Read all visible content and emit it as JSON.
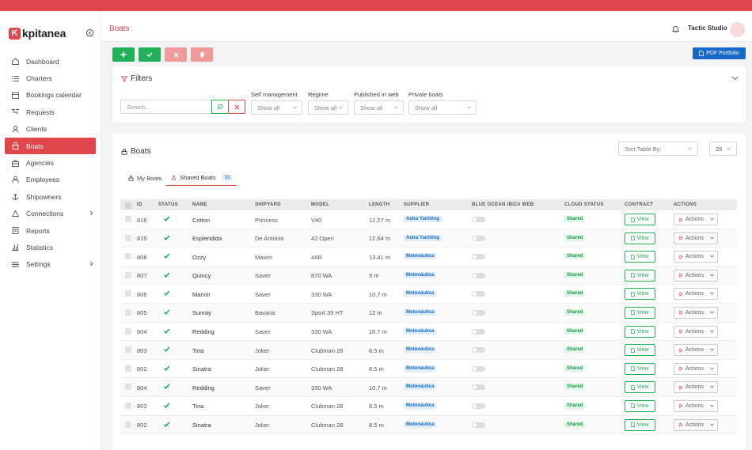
{
  "brand": {
    "name": "kpitanea",
    "logo_letter": "K",
    "accent": "#e0474c"
  },
  "sidebar": {
    "items": [
      {
        "label": "Dashboard",
        "icon": "home-icon",
        "active": false,
        "has_submenu": false
      },
      {
        "label": "Charters",
        "icon": "list-icon",
        "active": false,
        "has_submenu": false
      },
      {
        "label": "Bookings calendar",
        "icon": "calendar-icon",
        "active": false,
        "has_submenu": false
      },
      {
        "label": "Requests",
        "icon": "requests-icon",
        "active": false,
        "has_submenu": false
      },
      {
        "label": "Clients",
        "icon": "user-icon",
        "active": false,
        "has_submenu": false
      },
      {
        "label": "Boats",
        "icon": "boat-icon",
        "active": true,
        "has_submenu": false
      },
      {
        "label": "Agencies",
        "icon": "agency-icon",
        "active": false,
        "has_submenu": false
      },
      {
        "label": "Employees",
        "icon": "employees-icon",
        "active": false,
        "has_submenu": false
      },
      {
        "label": "Shipowners",
        "icon": "anchor-icon",
        "active": false,
        "has_submenu": false
      },
      {
        "label": "Connections",
        "icon": "connections-icon",
        "active": false,
        "has_submenu": true
      },
      {
        "label": "Reports",
        "icon": "report-icon",
        "active": false,
        "has_submenu": false
      },
      {
        "label": "Statistics",
        "icon": "chart-icon",
        "active": false,
        "has_submenu": false
      },
      {
        "label": "Settings",
        "icon": "settings-icon",
        "active": false,
        "has_submenu": true
      }
    ]
  },
  "header": {
    "title": "Boats",
    "user_name": "Tactic Studio"
  },
  "toolbar": {
    "pdf_label": "PDF Portfolio"
  },
  "filters": {
    "title": "Filters",
    "search_placeholder": "Search...",
    "selects": [
      {
        "label": "Self management",
        "value": "Show all"
      },
      {
        "label": "Regime",
        "value": "Show all"
      },
      {
        "label": "Published in web",
        "value": "Show all"
      },
      {
        "label": "Private boats",
        "value": "Show all"
      }
    ]
  },
  "boats": {
    "title": "Boats",
    "sort_placeholder": "Sort Table By:",
    "per_page": "25",
    "tabs": [
      {
        "label": "My Boats",
        "active": false,
        "badge": ""
      },
      {
        "label": "Shared Boats",
        "active": true,
        "badge": "33"
      }
    ],
    "columns": [
      "ID",
      "STATUS",
      "NAME",
      "SHIPYARD",
      "MODEL",
      "LENGTH",
      "SUPPLIER",
      "BLUE OCEAN IBIZA WEB",
      "CLOUD STATUS",
      "CONTRACT",
      "ACTIONS"
    ],
    "view_label": "View",
    "actions_label": "Actions",
    "rows": [
      {
        "id": "816",
        "name": "Cotton",
        "shipyard": "Princess",
        "model": "V40",
        "length": "12.27 m",
        "supplier": "Astra Yachting",
        "cloud": "Shared"
      },
      {
        "id": "815",
        "name": "Esplendida",
        "shipyard": "De Antonio",
        "model": "42 Open",
        "length": "12.64 m",
        "supplier": "Astra Yachting",
        "cloud": "Shared"
      },
      {
        "id": "808",
        "name": "Ozzy",
        "shipyard": "Maxim",
        "model": "44R",
        "length": "13.41 m",
        "supplier": "Motonáutica",
        "cloud": "Shared"
      },
      {
        "id": "807",
        "name": "Quincy",
        "shipyard": "Saver",
        "model": "870 WA",
        "length": "9 m",
        "supplier": "Motonáutica",
        "cloud": "Shared"
      },
      {
        "id": "806",
        "name": "Marvin",
        "shipyard": "Saver",
        "model": "330 WA",
        "length": "10.7 m",
        "supplier": "Motonáutica",
        "cloud": "Shared"
      },
      {
        "id": "805",
        "name": "Sunray",
        "shipyard": "Bavaria",
        "model": "Sport 39 HT",
        "length": "12 m",
        "supplier": "Motonáutica",
        "cloud": "Shared"
      },
      {
        "id": "804",
        "name": "Redding",
        "shipyard": "Saver",
        "model": "330 WA",
        "length": "10.7 m",
        "supplier": "Motonáutica",
        "cloud": "Shared"
      },
      {
        "id": "803",
        "name": "Tina",
        "shipyard": "Joker",
        "model": "Clubman 28",
        "length": "8.5 m",
        "supplier": "Motonáutica",
        "cloud": "Shared"
      },
      {
        "id": "802",
        "name": "Sinatra",
        "shipyard": "Joker",
        "model": "Clubman 28",
        "length": "8.5 m",
        "supplier": "Motonáutica",
        "cloud": "Shared"
      },
      {
        "id": "804",
        "name": "Redding",
        "shipyard": "Saver",
        "model": "330 WA",
        "length": "10.7 m",
        "supplier": "Motonáutica",
        "cloud": "Shared"
      },
      {
        "id": "803",
        "name": "Tina",
        "shipyard": "Joker",
        "model": "Clubman 28",
        "length": "8.5 m",
        "supplier": "Motonáutica",
        "cloud": "Shared"
      },
      {
        "id": "802",
        "name": "Sinatra",
        "shipyard": "Joker",
        "model": "Clubman 28",
        "length": "8.5 m",
        "supplier": "Motonáutica",
        "cloud": "Shared"
      }
    ]
  },
  "colors": {
    "accent": "#e0474c",
    "success": "#22b05a",
    "primary": "#1768c8",
    "danger_light": "#f09a9a"
  }
}
